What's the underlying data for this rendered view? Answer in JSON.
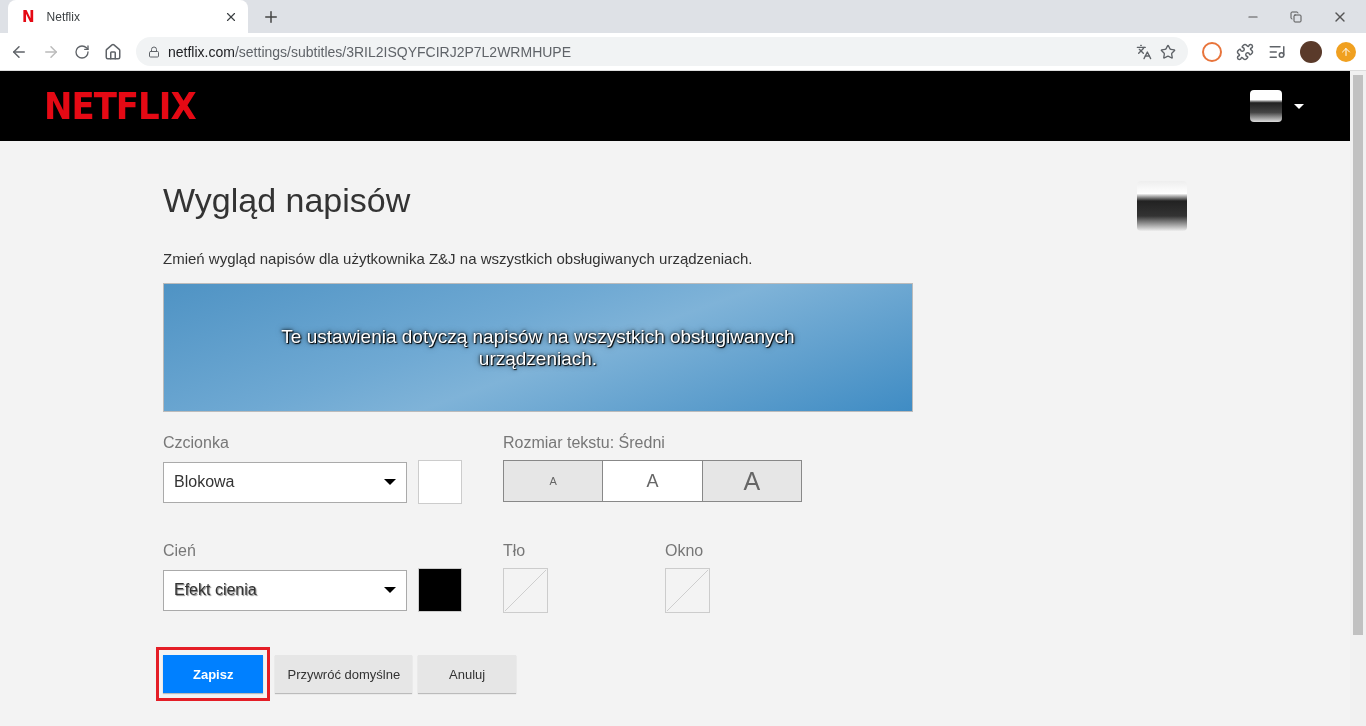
{
  "browser": {
    "favicon": "N",
    "tab_title": "Netflix",
    "url_host": "netflix.com",
    "url_path": "/settings/subtitles/3RIL2ISQYFCIRJ2P7L2WRMHUPE"
  },
  "header": {
    "logo": "NETFLIX"
  },
  "page": {
    "title": "Wygląd napisów",
    "description": "Zmień wygląd napisów dla użytkownika Z&J na wszystkich obsługiwanych urządzeniach.",
    "preview_text": "Te ustawienia dotyczą napisów na wszystkich obsługiwanych urządzeniach."
  },
  "font": {
    "label": "Czcionka",
    "value": "Blokowa",
    "color": "#ffffff"
  },
  "text_size": {
    "label": "Rozmiar tekstu: Średni",
    "options": [
      {
        "label": "A",
        "selected": false
      },
      {
        "label": "A",
        "selected": true
      },
      {
        "label": "A",
        "selected": false
      }
    ]
  },
  "shadow": {
    "label": "Cień",
    "value": "Efekt cienia",
    "color": "#000000"
  },
  "background": {
    "label": "Tło",
    "transparent": true
  },
  "window": {
    "label": "Okno",
    "transparent": true
  },
  "buttons": [
    {
      "label": "Zapisz",
      "kind": "primary",
      "highlighted": true
    },
    {
      "label": "Przywróć domyślne",
      "kind": "secondary",
      "highlighted": false
    },
    {
      "label": "Anuluj",
      "kind": "secondary",
      "highlighted": false
    }
  ]
}
